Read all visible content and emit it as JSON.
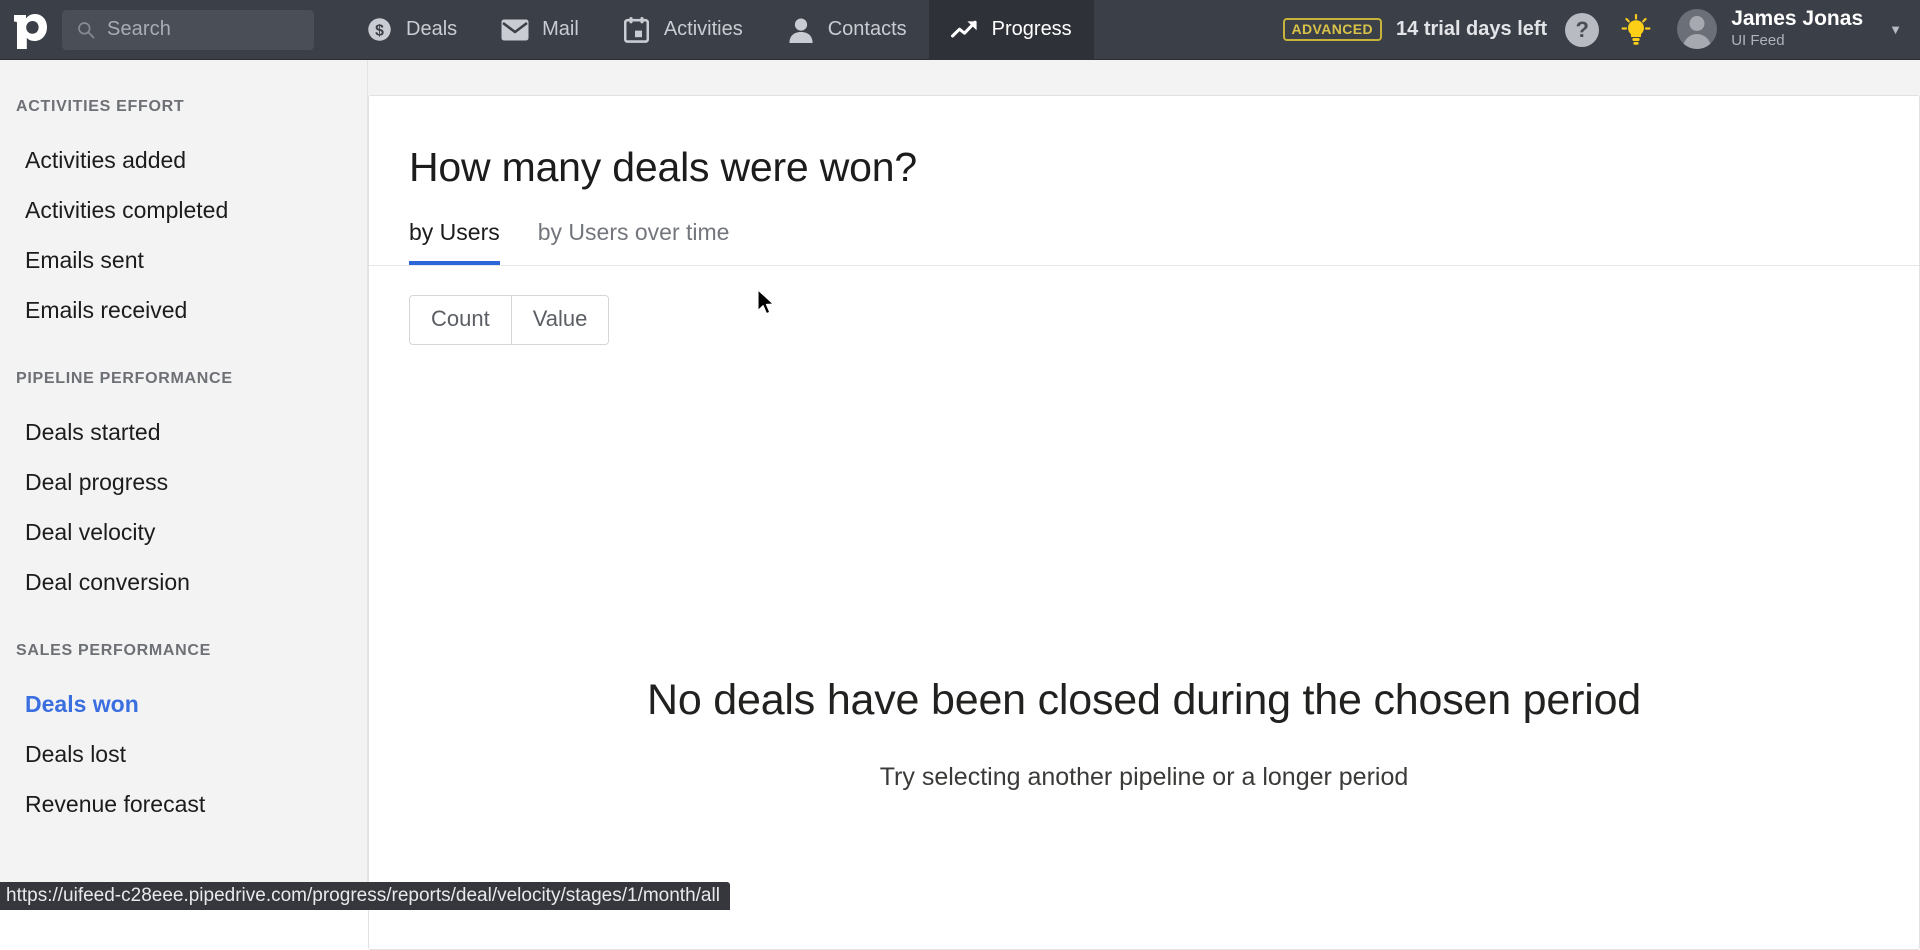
{
  "topnav": {
    "logo_icon": "pipedrive-logo-icon",
    "search": {
      "placeholder": "Search",
      "icon": "search-icon"
    },
    "items": [
      {
        "label": "Deals",
        "icon": "dollar-circle-icon",
        "active": false
      },
      {
        "label": "Mail",
        "icon": "envelope-icon",
        "active": false
      },
      {
        "label": "Activities",
        "icon": "calendar-icon",
        "active": false
      },
      {
        "label": "Contacts",
        "icon": "person-icon",
        "active": false
      },
      {
        "label": "Progress",
        "icon": "trend-up-icon",
        "active": true
      }
    ],
    "plan_badge": "ADVANCED",
    "trial_text": "14 trial days left",
    "help_icon_label": "?",
    "tips_icon": "lightbulb-icon",
    "user": {
      "name": "James Jonas",
      "company": "UI Feed",
      "avatar_icon": "avatar-icon",
      "caret_icon": "chevron-down-icon"
    }
  },
  "sidebar": {
    "sections": [
      {
        "title": "ACTIVITIES EFFORT",
        "items": [
          {
            "label": "Activities added",
            "active": false
          },
          {
            "label": "Activities completed",
            "active": false
          },
          {
            "label": "Emails sent",
            "active": false
          },
          {
            "label": "Emails received",
            "active": false
          }
        ]
      },
      {
        "title": "PIPELINE PERFORMANCE",
        "items": [
          {
            "label": "Deals started",
            "active": false
          },
          {
            "label": "Deal progress",
            "active": false
          },
          {
            "label": "Deal velocity",
            "active": false
          },
          {
            "label": "Deal conversion",
            "active": false
          }
        ]
      },
      {
        "title": "SALES PERFORMANCE",
        "items": [
          {
            "label": "Deals won",
            "active": true
          },
          {
            "label": "Deals lost",
            "active": false
          },
          {
            "label": "Revenue forecast",
            "active": false
          }
        ]
      }
    ]
  },
  "report": {
    "title": "How many deals were won?",
    "tabs": [
      {
        "label": "by Users",
        "active": true
      },
      {
        "label": "by Users over time",
        "active": false
      }
    ],
    "metric_toggle": {
      "options": [
        "Count",
        "Value"
      ]
    },
    "empty_state": {
      "title": "No deals have been closed during the chosen period",
      "subtitle": "Try selecting another pipeline or a longer period"
    }
  },
  "status_bar": {
    "url": "https://uifeed-c28eee.pipedrive.com/progress/reports/deal/velocity/stages/1/month/all"
  },
  "colors": {
    "nav_bg": "#3b3f47",
    "nav_active_bg": "#2e3138",
    "accent_blue": "#2b65d9",
    "sidebar_active": "#3b6fe0",
    "badge_yellow": "#d8c24a",
    "page_bg": "#f3f3f4"
  }
}
